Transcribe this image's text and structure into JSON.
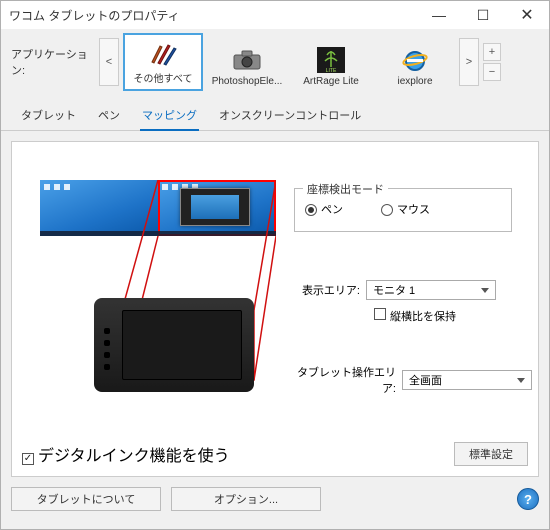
{
  "window": {
    "title": "ワコム タブレットのプロパティ"
  },
  "app_row": {
    "label": "アプリケーション:",
    "items": [
      {
        "label": "その他すべて",
        "selected": true
      },
      {
        "label": "PhotoshopEle..."
      },
      {
        "label": "ArtRage Lite"
      },
      {
        "label": "iexplore"
      }
    ]
  },
  "tabs": [
    {
      "label": "タブレット"
    },
    {
      "label": "ペン"
    },
    {
      "label": "マッピング",
      "selected": true
    },
    {
      "label": "オンスクリーンコントロール"
    }
  ],
  "mapping": {
    "mode_legend": "座標検出モード",
    "mode_pen": "ペン",
    "mode_mouse": "マウス",
    "mode_selected": "pen",
    "display_label": "表示エリア:",
    "display_value": "モニタ 1",
    "aspect_label": "縦横比を保持",
    "aspect_checked": false,
    "tablet_area_label": "タブレット操作エリア:",
    "tablet_area_value": "全画面",
    "digital_ink_label": "デジタルインク機能を使う",
    "digital_ink_checked": true,
    "default_button": "標準設定"
  },
  "footer": {
    "about": "タブレットについて",
    "options": "オプション..."
  }
}
